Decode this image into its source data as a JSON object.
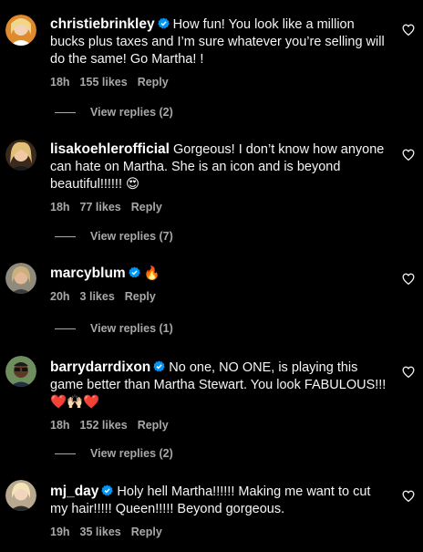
{
  "comments": [
    {
      "username": "christiebrinkley",
      "text": "How fun! You look like a million bucks plus taxes and I’m sure whatever you’re selling will do the same! Go Martha! !",
      "time": "18h",
      "likes": "155 likes",
      "reply": "Reply",
      "view_replies": "View replies (2)",
      "avatar_color": "#e08a2e"
    },
    {
      "username": "lisakoehlerofficial",
      "text": "Gorgeous! I don’t know how anyone can hate on Martha. She is an icon and is beyond beautiful!!!!!! 😍",
      "time": "18h",
      "likes": "77 likes",
      "reply": "Reply",
      "view_replies": "View replies (7)",
      "avatar_color": "#c9a873"
    },
    {
      "username": "marcyblum",
      "text": "🔥",
      "time": "20h",
      "likes": "3 likes",
      "reply": "Reply",
      "view_replies": "View replies (1)",
      "avatar_color": "#b0a48c"
    },
    {
      "username": "barrydarrdixon",
      "text": "No one, NO ONE, is playing this game better than Martha Stewart. You look FABULOUS!!! ❤️🙌🏻❤️",
      "time": "18h",
      "likes": "152 likes",
      "reply": "Reply",
      "view_replies": "View replies (2)",
      "avatar_color": "#6f8e5e"
    },
    {
      "username": "mj_day",
      "text": "Holy hell Martha!!!!!! Making me want to cut my hair!!!!! Queen!!!!! Beyond gorgeous.",
      "time": "19h",
      "likes": "35 likes",
      "reply": "Reply",
      "avatar_color": "#d8c7a8"
    }
  ],
  "colors": {
    "background": "#000000",
    "text": "#f5f5f5",
    "muted": "#a8a8a8",
    "verified": "#0095f6"
  }
}
